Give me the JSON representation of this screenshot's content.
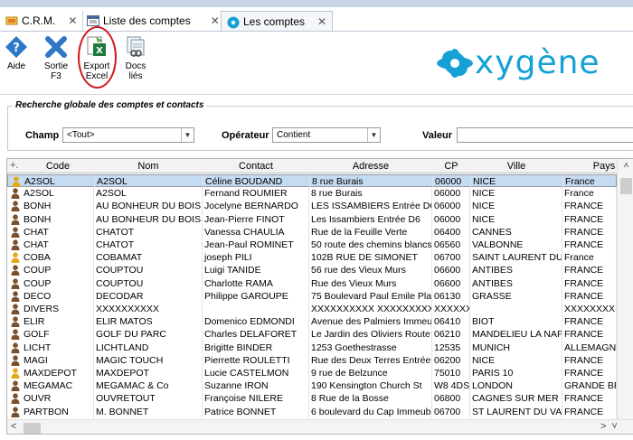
{
  "tabs": [
    {
      "label": "C.R.M.",
      "close": "✕"
    },
    {
      "label": "Liste des comptes",
      "close": "✕"
    },
    {
      "label": "Les comptes",
      "close": "✕"
    }
  ],
  "toolbar": {
    "aide": "Aide",
    "sortie_l1": "Sortie",
    "sortie_l2": "F3",
    "export_l1": "Export",
    "export_l2": "Excel",
    "docs_l1": "Docs",
    "docs_l2": "liés"
  },
  "logo": {
    "text": "xygène"
  },
  "search": {
    "title": "Recherche globale des comptes et contacts",
    "champ_label": "Champ",
    "champ_value": "<Tout>",
    "operateur_label": "Opérateur",
    "operateur_value": "Contient",
    "valeur_label": "Valeur"
  },
  "table": {
    "headers": [
      "Code",
      "Nom",
      "Contact",
      "Adresse",
      "CP",
      "Ville",
      "Pays"
    ],
    "rows": [
      [
        "A2SOL",
        "A2SOL",
        "Céline BOUDAND",
        "8 rue Burais",
        "06000",
        "NICE",
        "France"
      ],
      [
        "A2SOL",
        "A2SOL",
        "Fernand ROUMIER",
        "8 rue Burais",
        "06000",
        "NICE",
        "France"
      ],
      [
        "BONH",
        "AU BONHEUR DU BOIS",
        "Jocelyne BERNARDO",
        "LES ISSAMBIERS Entrée D6",
        "06000",
        "NICE",
        "FRANCE"
      ],
      [
        "BONH",
        "AU BONHEUR DU BOIS",
        "Jean-Pierre FINOT",
        "Les Issambiers Entrée D6",
        "06000",
        "NICE",
        "FRANCE"
      ],
      [
        "CHAT",
        "CHATOT",
        "Vanessa CHAULIA",
        "Rue de la Feuille Verte",
        "06400",
        "CANNES",
        "FRANCE"
      ],
      [
        "CHAT",
        "CHATOT",
        "Jean-Paul ROMINET",
        "50 route des chemins blancs",
        "06560",
        "VALBONNE",
        "FRANCE"
      ],
      [
        "COBA",
        "COBAMAT",
        "joseph PILI",
        "102B RUE DE SIMONET",
        "06700",
        "SAINT LAURENT DU VAR",
        "France"
      ],
      [
        "COUP",
        "COUPTOU",
        "Luigi TANIDE",
        "56 rue des Vieux Murs",
        "06600",
        "ANTIBES",
        "FRANCE"
      ],
      [
        "COUP",
        "COUPTOU",
        "Charlotte RAMA",
        "Rue des Vieux Murs",
        "06600",
        "ANTIBES",
        "FRANCE"
      ],
      [
        "DECO",
        "DECODAR",
        "Philippe GAROUPE",
        "75 Boulevard Paul Emile Plan",
        "06130",
        "GRASSE",
        "FRANCE"
      ],
      [
        "DIVERS",
        "XXXXXXXXXX",
        "",
        "XXXXXXXXXX XXXXXXXXXX",
        "XXXXXXXXXXXXXXXX",
        "",
        "XXXXXXXX"
      ],
      [
        "ELIR",
        "ELIR MATOS",
        "Domenico EDMONDI",
        "Avenue des Palmiers Immeub",
        "06410",
        "BIOT",
        "FRANCE"
      ],
      [
        "GOLF",
        "GOLF DU PARC",
        "Charles DELAFORET",
        "Le Jardin des Oliviers Route",
        "06210",
        "MANDELIEU LA NAPOULE",
        "FRANCE"
      ],
      [
        "LICHT",
        "LICHTLAND",
        "Brigitte BINDER",
        "1253  Goethestrasse",
        "12535",
        "MUNICH",
        "ALLEMAGNE"
      ],
      [
        "MAGI",
        "MAGIC TOUCH",
        "Pierrette ROULETTI",
        "Rue des Deux Terres Entrée",
        "06200",
        "NICE",
        "FRANCE"
      ],
      [
        "MAXDEPOT",
        "MAXDEPOT",
        "Lucie CASTELMON",
        "9 rue de Belzunce",
        "75010",
        "PARIS 10",
        "FRANCE"
      ],
      [
        "MEGAMAC",
        "MEGAMAC & Co",
        "Suzanne IRON",
        "190 Kensington Church St",
        "W8 4DS",
        "LONDON",
        "GRANDE BRETAGNE"
      ],
      [
        "OUVR",
        "OUVRETOUT",
        "Françoise NILERE",
        "8 Rue de la Bosse",
        "06800",
        "CAGNES SUR MER",
        "FRANCE"
      ],
      [
        "PARTBON",
        "M. BONNET",
        "Patrice BONNET",
        "6 boulevard du Cap Immeubl",
        "06700",
        "ST LAURENT DU VAR",
        "FRANCE"
      ]
    ],
    "row_icon_colors": [
      "#e2a91a",
      "#7a4f2a",
      "#7a4f2a",
      "#7a4f2a",
      "#7a4f2a",
      "#7a4f2a",
      "#e2a91a",
      "#7a4f2a",
      "#7a4f2a",
      "#7a4f2a",
      "#7a4f2a",
      "#7a4f2a",
      "#7a4f2a",
      "#7a4f2a",
      "#7a4f2a",
      "#e2a91a",
      "#7a4f2a",
      "#7a4f2a",
      "#7a4f2a"
    ],
    "selected_row": 0
  },
  "colors": {
    "logo_blue": "#15a1d6",
    "selection": "#c5dbf2",
    "highlight_ring": "#d0181f",
    "excel_green": "#1f7a3c"
  }
}
